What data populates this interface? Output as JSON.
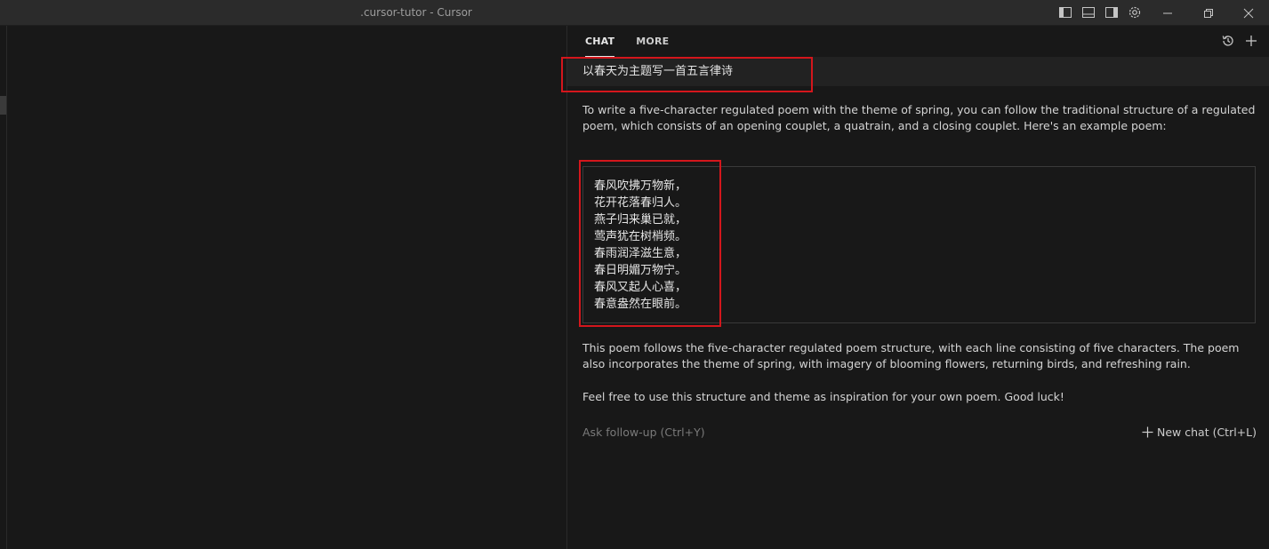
{
  "window": {
    "title": ".cursor-tutor - Cursor"
  },
  "titlebar_icons": [
    "sidebar-left-icon",
    "panel-bottom-icon",
    "sidebar-right-icon",
    "gear-icon"
  ],
  "window_controls": [
    "minimize-icon",
    "restore-icon",
    "close-icon"
  ],
  "panel": {
    "tabs": [
      {
        "label": "CHAT",
        "active": true
      },
      {
        "label": "MORE",
        "active": false
      }
    ],
    "actions": [
      "history-icon",
      "plus-icon"
    ]
  },
  "chat": {
    "user_message": "以春天为主题写一首五言律诗",
    "intro": "To write a five-character regulated poem with the theme of spring, you can follow the traditional structure of a regulated poem, which consists of an opening couplet, a quatrain, and a closing couplet. Here's an example poem:",
    "poem_lines": [
      "春风吹拂万物新，",
      "花开花落春归人。",
      "燕子归来巢已就，",
      "莺声犹在树梢频。",
      "春雨润泽滋生意，",
      "春日明媚万物宁。",
      "春风又起人心喜，",
      "春意盎然在眼前。"
    ],
    "explanation": "This poem follows the five-character regulated poem structure, with each line consisting of five characters. The poem also incorporates the theme of spring, with imagery of blooming flowers, returning birds, and refreshing rain.",
    "closing": "Feel free to use this structure and theme as inspiration for your own poem. Good luck!",
    "followup_placeholder": "Ask follow-up (Ctrl+Y)",
    "new_chat_label": "New chat (Ctrl+L)"
  },
  "colors": {
    "highlight": "#d4161c",
    "background": "#181818",
    "titlebar": "#2b2b2b"
  }
}
